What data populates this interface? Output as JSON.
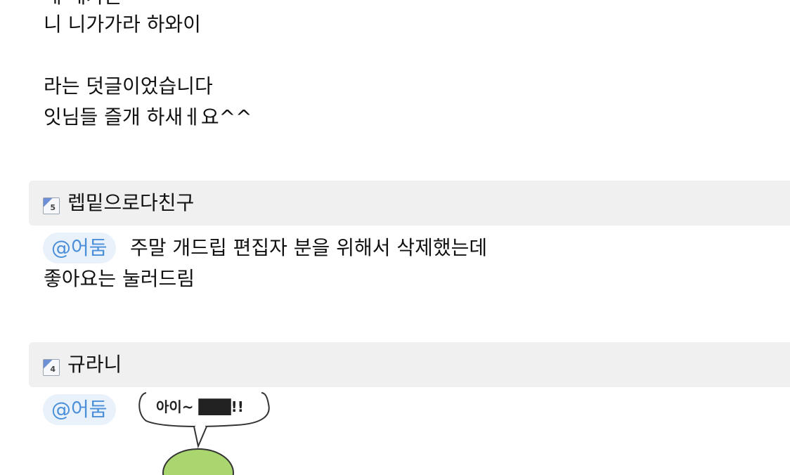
{
  "post": {
    "lines": [
      "니 니가가라 하와이",
      "라는 덧글이었습니다",
      "잇님들 즐개 하새ㅔ요^^"
    ],
    "partial_top_line": "네 네가는"
  },
  "comments": [
    {
      "level": "5",
      "nickname": "렙밑으로다친구",
      "mention": "@어둠",
      "text_line1": "주말 개드립 편집자 분을 위해서 삭제했는데",
      "text_line2": "좋아요는 눌러드림"
    },
    {
      "level": "4",
      "nickname": "규라니",
      "mention": "@어둠",
      "image_caption": "아이~ ███!!"
    }
  ],
  "colors": {
    "mention_bg": "#e9f1fb",
    "mention_text": "#4a8fd8",
    "header_bg": "#f0f0f0",
    "meme_green": "#a9d66e"
  },
  "icons": {
    "level_icon": "user-level-badge-icon"
  }
}
